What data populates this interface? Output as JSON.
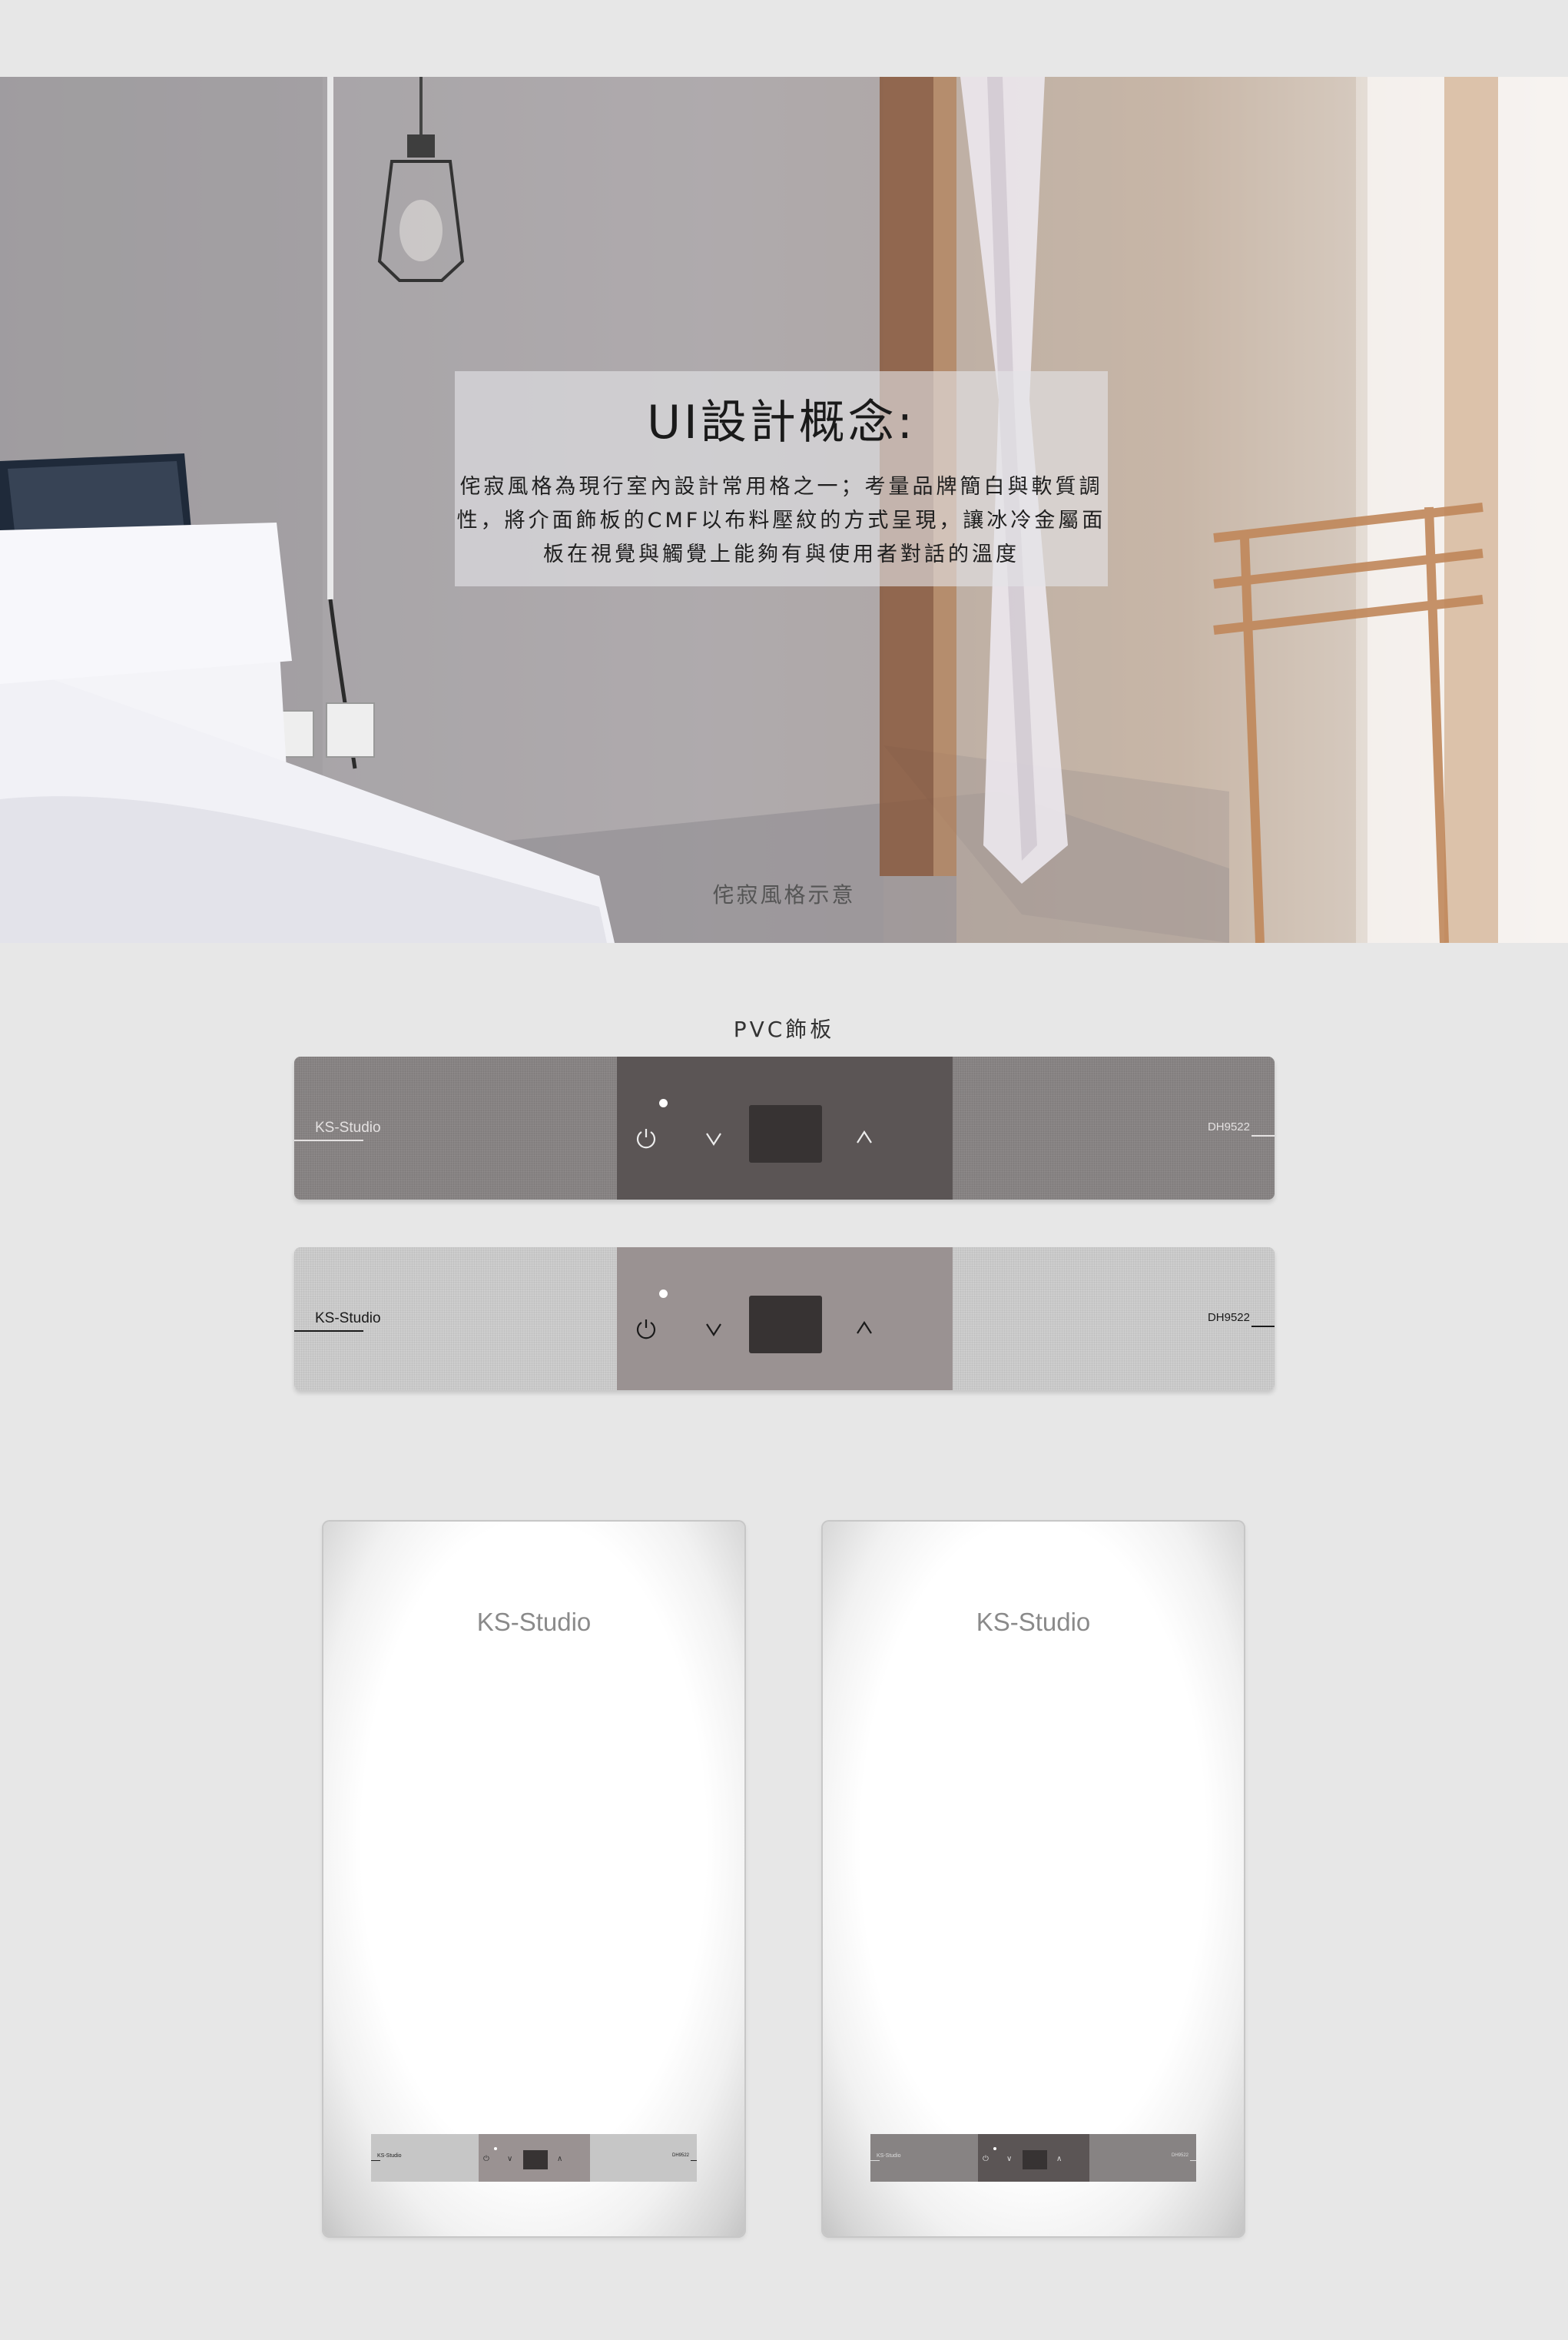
{
  "hero": {
    "concept_title": "UI設計概念:",
    "concept_body": "侘寂風格為現行室內設計常用格之一；考量品牌簡白與軟質調性，將介面飾板的CMF以布料壓紋的方式呈現，讓冰冷金屬面板在視覺與觸覺上能夠有與使用者對話的溫度",
    "caption": "侘寂風格示意"
  },
  "panels": {
    "section_title": "PVC飾板",
    "dark": {
      "brand": "KS-Studio",
      "model": "DH9522"
    },
    "light": {
      "brand": "KS-Studio",
      "model": "DH9522"
    }
  },
  "controls": {
    "power_icon": "power-icon",
    "down_icon": "chevron-down-icon",
    "up_icon": "chevron-up-icon"
  },
  "heaters": {
    "left": {
      "brand": "KS-Studio",
      "mini_brand": "KS-Studio",
      "mini_model": "DH9522",
      "mini_power": "⏻",
      "mini_down": "∨",
      "mini_up": "∧"
    },
    "right": {
      "brand": "KS-Studio",
      "mini_brand": "KS-Studio",
      "mini_model": "DH9522",
      "mini_power": "⏻",
      "mini_down": "∨",
      "mini_up": "∧"
    }
  },
  "colors": {
    "background": "#e7e7e7",
    "panel_dark": "#878383",
    "panel_dark_center": "#5b5555",
    "panel_light": "#c9c9c9",
    "panel_light_center": "#9a9292",
    "display": "#373333"
  }
}
